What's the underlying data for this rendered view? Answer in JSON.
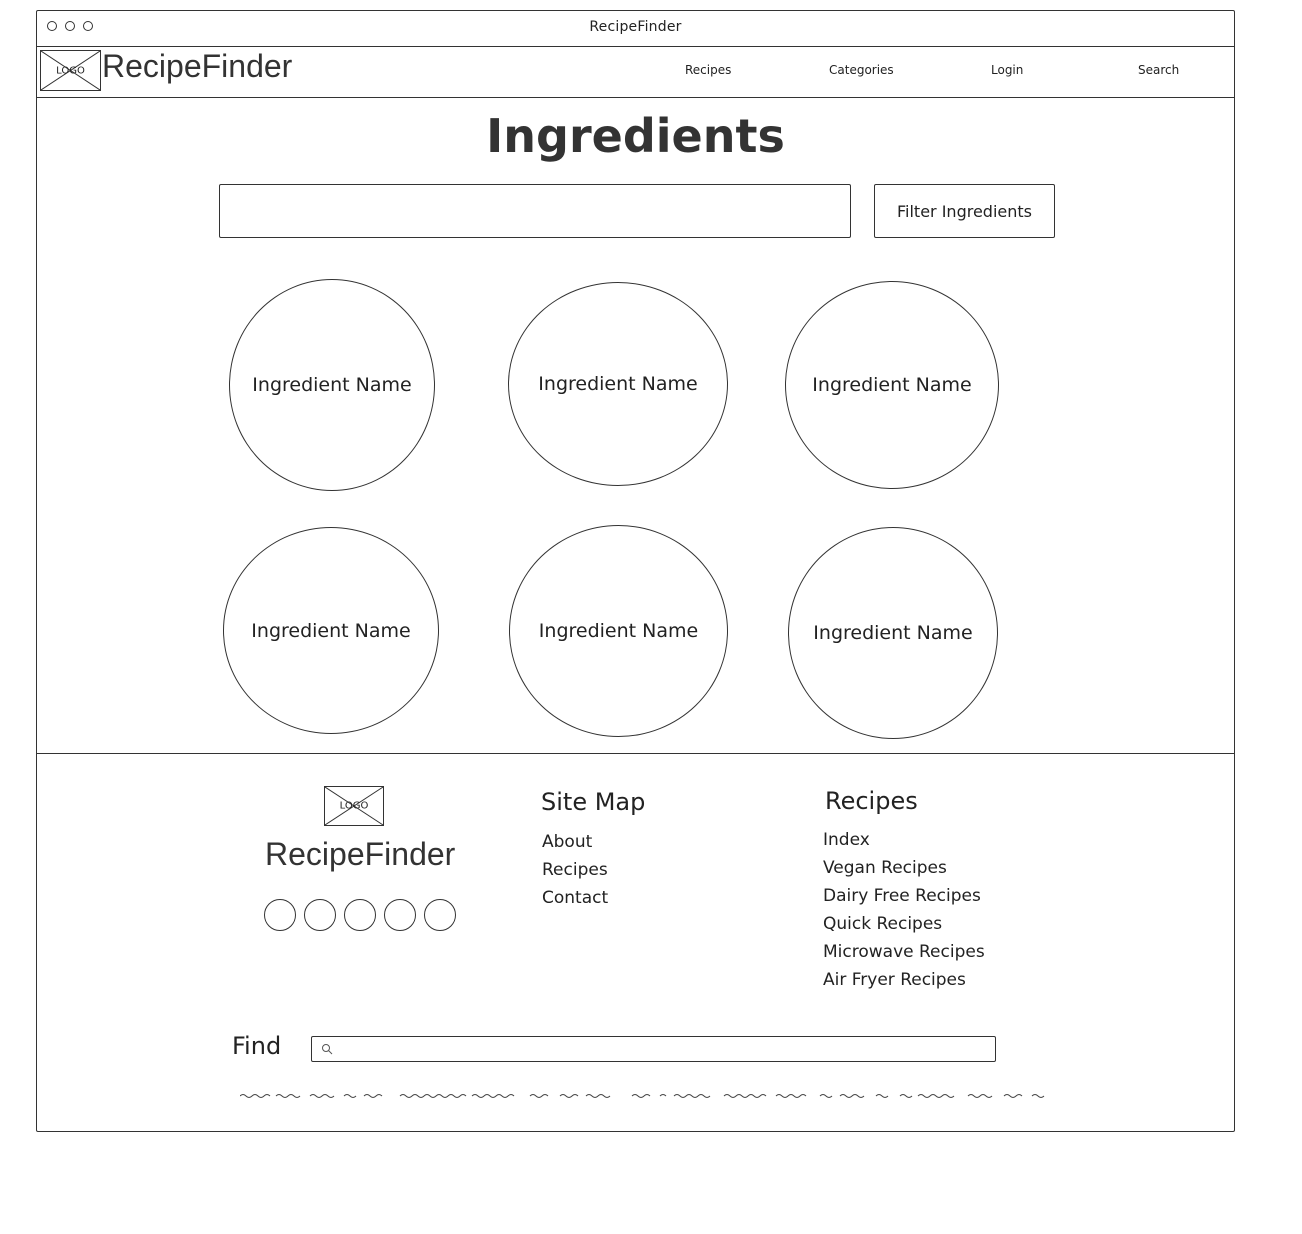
{
  "window": {
    "title": "RecipeFinder"
  },
  "navbar": {
    "logo_text": "LOGO",
    "brand": "RecipeFinder",
    "links": [
      "Recipes",
      "Categories",
      "Login",
      "Search"
    ]
  },
  "main": {
    "title": "Ingredients",
    "filter": {
      "input_value": "",
      "button_label": "Filter Ingredients"
    },
    "ingredients": [
      "Ingredient Name",
      "Ingredient Name",
      "Ingredient Name",
      "Ingredient Name",
      "Ingredient Name",
      "Ingredient Name"
    ]
  },
  "footer": {
    "logo_text": "LOGO",
    "brand": "RecipeFinder",
    "social_icons": [
      "social-icon",
      "social-icon",
      "social-icon",
      "social-icon",
      "social-icon"
    ],
    "site_map": {
      "heading": "Site Map",
      "items": [
        "About",
        "Recipes",
        "Contact"
      ]
    },
    "recipes": {
      "heading": "Recipes",
      "items": [
        "Index",
        "Vegan Recipes",
        "Dairy Free Recipes",
        "Quick Recipes",
        "Microwave Recipes",
        "Air Fryer Recipes"
      ]
    },
    "find": {
      "label": "Find",
      "input_value": "",
      "icon": "search-icon"
    }
  }
}
